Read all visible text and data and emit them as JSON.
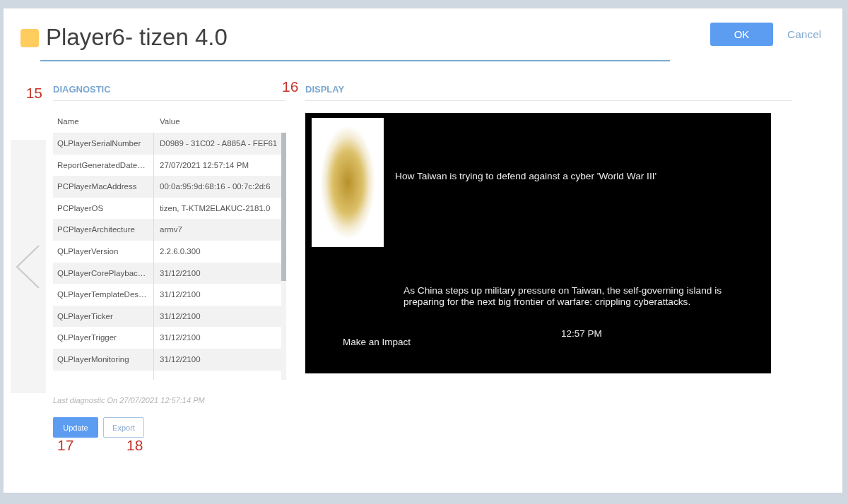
{
  "dialog": {
    "title": "Player6- tizen 4.0",
    "buttons": [
      {
        "label": "OK",
        "kind": "primary"
      },
      {
        "label": "Cancel",
        "kind": "link"
      }
    ]
  },
  "diagnostic": {
    "callout": "15",
    "heading": "DIAGNOSTIC",
    "columns": [
      "Name",
      "Value"
    ],
    "rows": [
      {
        "name": "QLPlayerSerialNumber",
        "value": "D0989 - 31C02 - A885A - FEF61"
      },
      {
        "name": "ReportGeneratedDate…",
        "value": "27/07/2021 12:57:14 PM"
      },
      {
        "name": "PCPlayerMacAddress",
        "value": "00:0a:95:9d:68:16 - 00:7c:2d:6"
      },
      {
        "name": "PCPlayerOS",
        "value": "tizen, T-KTM2ELAKUC-2181.0"
      },
      {
        "name": "PCPlayerArchitecture",
        "value": "armv7"
      },
      {
        "name": "QLPlayerVersion",
        "value": "2.2.6.0.300"
      },
      {
        "name": "QLPlayerCorePlaybac…",
        "value": "31/12/2100"
      },
      {
        "name": "QLPlayerTemplateDes…",
        "value": "31/12/2100"
      },
      {
        "name": "QLPlayerTicker",
        "value": "31/12/2100"
      },
      {
        "name": "QLPlayerTrigger",
        "value": "31/12/2100"
      },
      {
        "name": "QLPlayerMonitoring",
        "value": "31/12/2100"
      }
    ],
    "last_run": "Last diagnostic On 27/07/2021 12:57:14 PM",
    "actions": [
      {
        "label": "Update",
        "kind": "primary",
        "callout": "17"
      },
      {
        "label": "Export",
        "kind": "outline",
        "callout": "18"
      }
    ]
  },
  "display": {
    "callout": "16",
    "heading": "DISPLAY",
    "screen": {
      "headline": "How Taiwan is trying to defend against a cyber 'World War III'",
      "article": "As China steps up military pressure on Taiwan, the self-governing island is preparing for the next big frontier of warfare: crippling cyberattacks.",
      "clock": "12:57 PM",
      "tagline": "Make an Impact"
    }
  }
}
